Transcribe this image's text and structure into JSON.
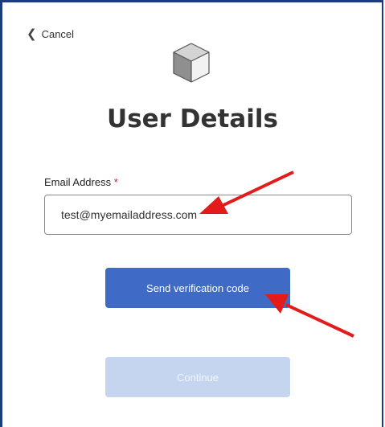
{
  "nav": {
    "cancel_label": "Cancel"
  },
  "header": {
    "title": "User Details"
  },
  "form": {
    "email_label": "Email Address",
    "required_marker": "*",
    "email_value": "test@myemailaddress.com"
  },
  "buttons": {
    "send_label": "Send verification code",
    "continue_label": "Continue"
  },
  "icons": {
    "back": "chevron-left-icon",
    "logo": "cube-logo-icon",
    "annotation": "red-arrow-icon"
  },
  "colors": {
    "primary": "#3f6bc6",
    "disabled": "#c5d4ef",
    "annotation": "#e31b1b",
    "required": "#d02020"
  }
}
